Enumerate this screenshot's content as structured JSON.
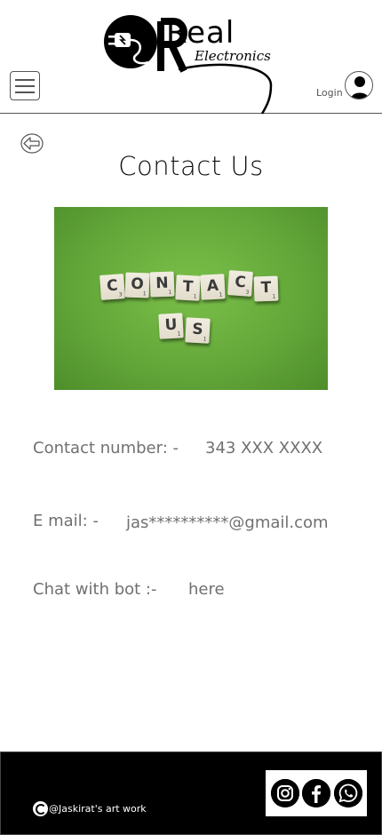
{
  "header": {
    "menu_icon": "hamburger-menu-icon",
    "logo": {
      "word": "Real",
      "subtitle": "Electronics",
      "icon": "power-plug-icon"
    },
    "login_label": "Login",
    "user_icon": "user-avatar-icon"
  },
  "nav": {
    "back_icon": "back-arrow-icon"
  },
  "main": {
    "title": "Contact Us",
    "hero_image": {
      "icon": "contact-us-tiles-image",
      "tiles_line1": [
        "C",
        "O",
        "N",
        "T",
        "A",
        "C",
        "T"
      ],
      "tiles_line2": [
        "U",
        "S"
      ],
      "tile_points_line1": [
        "3",
        "1",
        "1",
        "1",
        "1",
        "3",
        "1"
      ],
      "tile_points_line2": [
        "1",
        "1"
      ]
    },
    "contact_number_label": "Contact number: -",
    "contact_number_value": "343 XXX XXXX",
    "email_label": "E mail: -",
    "email_value": "jas**********@gmail.com",
    "chat_label": "Chat with bot  :-",
    "chat_link": "here"
  },
  "footer": {
    "copyright_icon": "copyright-icon",
    "copyright_text": "@Jaskirat's art work",
    "social_icons": [
      "instagram-icon",
      "facebook-icon",
      "whatsapp-icon"
    ]
  },
  "colors": {
    "text_gray": "#707070",
    "footer_bg": "#000000",
    "hero_green": "#64a83a",
    "tile_cream": "#e9e4d4"
  }
}
